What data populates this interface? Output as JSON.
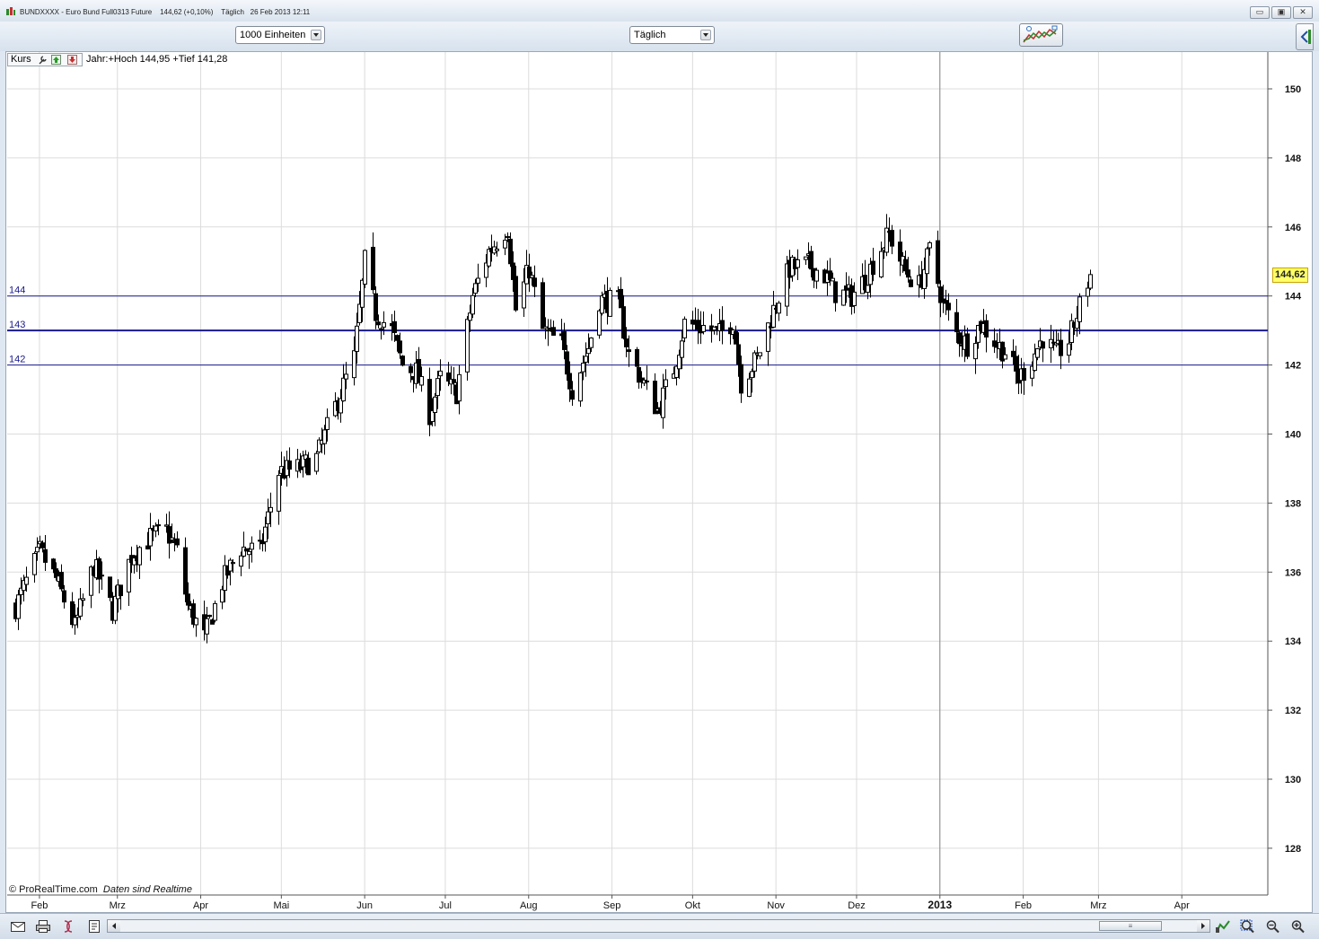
{
  "window": {
    "title": "BUNDXXXX - Euro Bund Full0313 Future",
    "quote": "144,62 (+0,10%)",
    "interval": "Täglich",
    "datetime": "26 Feb 2013 12:11",
    "buttons": {
      "minimize": "▭",
      "maximize": "▣",
      "close": "✕"
    }
  },
  "toolbar": {
    "units_select": "1000 Einheiten",
    "period_select": "Täglich",
    "chart_type_icon": "chart-style-icon",
    "side_tab_icon": "expand-panel-icon"
  },
  "legend": {
    "series_label": "Kurs",
    "year_info": "Jahr:+Hoch 144,95 +Tief 141,28"
  },
  "attribution": {
    "copyright": "© ProRealTime.com",
    "realtime": "Daten sind Realtime"
  },
  "current_price": "144,62",
  "statusbar": {
    "icons": [
      "mail-icon",
      "print-icon",
      "indicator-icon",
      "clipboard-icon",
      "chart-settings-icon",
      "zoom-select-icon",
      "zoom-out-icon",
      "zoom-in-icon"
    ],
    "scroll_thumb": "≡"
  },
  "colors": {
    "up_candle": "#ffffff",
    "down_candle": "#000000",
    "level_line": "#1a1a8c",
    "grid": "#dcdcdc",
    "price_tag": "#ffff66"
  },
  "chart_data": {
    "type": "candlestick",
    "title": "",
    "ylim": [
      126.6,
      150.9
    ],
    "y_ticks": [
      128,
      130,
      132,
      134,
      136,
      138,
      140,
      142,
      144,
      146,
      148,
      150
    ],
    "x_ticks": [
      {
        "label": "Feb",
        "date": "2012-02-01"
      },
      {
        "label": "Mrz",
        "date": "2012-03-01"
      },
      {
        "label": "Apr",
        "date": "2012-04-01"
      },
      {
        "label": "Mai",
        "date": "2012-05-01"
      },
      {
        "label": "Jun",
        "date": "2012-06-01"
      },
      {
        "label": "Jul",
        "date": "2012-07-01"
      },
      {
        "label": "Aug",
        "date": "2012-08-01"
      },
      {
        "label": "Sep",
        "date": "2012-09-01"
      },
      {
        "label": "Okt",
        "date": "2012-10-01"
      },
      {
        "label": "Nov",
        "date": "2012-11-01"
      },
      {
        "label": "Dez",
        "date": "2012-12-01"
      },
      {
        "label": "2013",
        "date": "2013-01-01",
        "bold": true
      },
      {
        "label": "Feb",
        "date": "2013-02-01"
      },
      {
        "label": "Mrz",
        "date": "2013-03-01"
      },
      {
        "label": "Apr",
        "date": "2013-04-01"
      }
    ],
    "x_range": [
      "2012-01-20",
      "2013-05-03"
    ],
    "horizontal_lines": [
      {
        "label": "144",
        "value": 144.0,
        "width": 1
      },
      {
        "label": "143",
        "value": 143.0,
        "width": 2
      },
      {
        "label": "142",
        "value": 142.0,
        "width": 1
      }
    ],
    "year_divider": "2013-01-01",
    "price_path": [
      {
        "date": "2012-01-23",
        "close": 135.0
      },
      {
        "date": "2012-02-01",
        "close": 136.6
      },
      {
        "date": "2012-02-07",
        "close": 135.8
      },
      {
        "date": "2012-02-14",
        "close": 134.4
      },
      {
        "date": "2012-02-21",
        "close": 136.2
      },
      {
        "date": "2012-02-28",
        "close": 134.9
      },
      {
        "date": "2012-03-06",
        "close": 136.5
      },
      {
        "date": "2012-03-13",
        "close": 137.0
      },
      {
        "date": "2012-03-19",
        "close": 137.2
      },
      {
        "date": "2012-03-23",
        "close": 136.6
      },
      {
        "date": "2012-03-27",
        "close": 135.0
      },
      {
        "date": "2012-04-02",
        "close": 134.1
      },
      {
        "date": "2012-04-09",
        "close": 135.7
      },
      {
        "date": "2012-04-16",
        "close": 136.7
      },
      {
        "date": "2012-04-23",
        "close": 136.6
      },
      {
        "date": "2012-04-30",
        "close": 138.9
      },
      {
        "date": "2012-05-07",
        "close": 139.0
      },
      {
        "date": "2012-05-14",
        "close": 139.3
      },
      {
        "date": "2012-05-21",
        "close": 140.8
      },
      {
        "date": "2012-05-28",
        "close": 142.2
      },
      {
        "date": "2012-06-01",
        "close": 145.0
      },
      {
        "date": "2012-06-05",
        "close": 143.5
      },
      {
        "date": "2012-06-11",
        "close": 143.0
      },
      {
        "date": "2012-06-15",
        "close": 142.0
      },
      {
        "date": "2012-06-20",
        "close": 141.8
      },
      {
        "date": "2012-06-25",
        "close": 140.6
      },
      {
        "date": "2012-06-29",
        "close": 141.6
      },
      {
        "date": "2012-07-05",
        "close": 141.2
      },
      {
        "date": "2012-07-11",
        "close": 144.0
      },
      {
        "date": "2012-07-17",
        "close": 145.3
      },
      {
        "date": "2012-07-24",
        "close": 146.0
      },
      {
        "date": "2012-07-27",
        "close": 143.6
      },
      {
        "date": "2012-08-01",
        "close": 144.8
      },
      {
        "date": "2012-08-06",
        "close": 143.0
      },
      {
        "date": "2012-08-13",
        "close": 142.6
      },
      {
        "date": "2012-08-17",
        "close": 141.3
      },
      {
        "date": "2012-08-23",
        "close": 142.5
      },
      {
        "date": "2012-08-27",
        "close": 143.9
      },
      {
        "date": "2012-09-03",
        "close": 143.8
      },
      {
        "date": "2012-09-07",
        "close": 142.3
      },
      {
        "date": "2012-09-12",
        "close": 141.6
      },
      {
        "date": "2012-09-18",
        "close": 140.7
      },
      {
        "date": "2012-09-24",
        "close": 141.9
      },
      {
        "date": "2012-09-28",
        "close": 143.2
      },
      {
        "date": "2012-10-05",
        "close": 143.1
      },
      {
        "date": "2012-10-11",
        "close": 142.9
      },
      {
        "date": "2012-10-16",
        "close": 143.3
      },
      {
        "date": "2012-10-19",
        "close": 141.5
      },
      {
        "date": "2012-10-25",
        "close": 142.2
      },
      {
        "date": "2012-10-31",
        "close": 143.6
      },
      {
        "date": "2012-11-06",
        "close": 144.8
      },
      {
        "date": "2012-11-13",
        "close": 144.9
      },
      {
        "date": "2012-11-19",
        "close": 144.6
      },
      {
        "date": "2012-11-23",
        "close": 144.1
      },
      {
        "date": "2012-11-29",
        "close": 144.0
      },
      {
        "date": "2012-12-04",
        "close": 144.5
      },
      {
        "date": "2012-12-10",
        "close": 145.4
      },
      {
        "date": "2012-12-13",
        "close": 145.8
      },
      {
        "date": "2012-12-19",
        "close": 144.7
      },
      {
        "date": "2012-12-24",
        "close": 144.3
      },
      {
        "date": "2012-12-28",
        "close": 145.3
      },
      {
        "date": "2013-01-02",
        "close": 143.8
      },
      {
        "date": "2013-01-07",
        "close": 142.9
      },
      {
        "date": "2013-01-11",
        "close": 142.6
      },
      {
        "date": "2013-01-16",
        "close": 143.2
      },
      {
        "date": "2013-01-22",
        "close": 142.6
      },
      {
        "date": "2013-01-25",
        "close": 142.4
      },
      {
        "date": "2013-01-30",
        "close": 141.6
      },
      {
        "date": "2013-02-04",
        "close": 142.2
      },
      {
        "date": "2013-02-08",
        "close": 142.8
      },
      {
        "date": "2013-02-13",
        "close": 142.3
      },
      {
        "date": "2013-02-18",
        "close": 142.7
      },
      {
        "date": "2013-02-22",
        "close": 143.7
      },
      {
        "date": "2013-02-26",
        "close": 144.62
      }
    ]
  }
}
